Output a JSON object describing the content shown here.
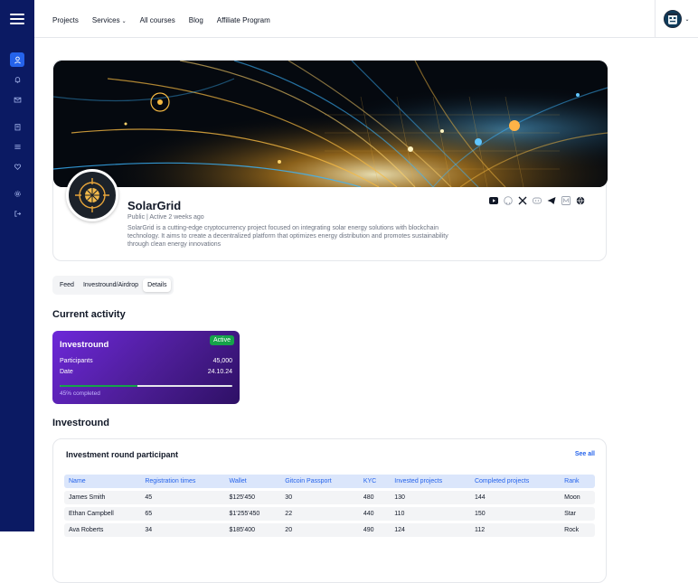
{
  "nav": {
    "items": [
      {
        "label": "Projects",
        "has_dropdown": false
      },
      {
        "label": "Services",
        "has_dropdown": true
      },
      {
        "label": "All courses",
        "has_dropdown": false
      },
      {
        "label": "Blog",
        "has_dropdown": false
      },
      {
        "label": "Affiliate Program",
        "has_dropdown": false
      }
    ],
    "chevron": "⌄"
  },
  "sidebar": {
    "icons": [
      "user-icon",
      "bell-icon",
      "mail-icon",
      "clipboard-icon",
      "list-icon",
      "heart-icon",
      "settings-icon",
      "logout-icon"
    ],
    "active": "user-icon"
  },
  "profile": {
    "name": "SolarGrid",
    "meta": "Public | Active 2 weeks ago",
    "description": "SolarGrid is a cutting-edge cryptocurrency project focused on integrating solar energy solutions with blockchain technology. It aims to create a decentralized platform that optimizes energy distribution and promotes sustainability through clean energy innovations",
    "socials": [
      "youtube-icon",
      "github-icon",
      "x-icon",
      "discord-icon",
      "telegram-icon",
      "medium-icon",
      "globe-icon"
    ]
  },
  "tabs": {
    "feed": "Feed",
    "investround": "Investround/Airdrop",
    "details": "Details",
    "active": "details"
  },
  "current_activity": {
    "heading": "Current activity",
    "card": {
      "title": "Investround",
      "badge": "Active",
      "participants_label": "Participants",
      "participants_value": "45,000",
      "date_label": "Date",
      "date_value": "24.10.24",
      "progress": 0.45,
      "completed_text": "45% completed"
    }
  },
  "investround": {
    "heading": "Investround",
    "table_title": "Investment round participant",
    "see_all": "See all",
    "columns": [
      "Name",
      "Registration times",
      "Wallet",
      "Gitcoin Passport",
      "KYC",
      "Invested projects",
      "Completed projects",
      "Rank"
    ],
    "rows": [
      [
        "James Smith",
        "45",
        "$125'450",
        "30",
        "480",
        "130",
        "144",
        "Moon"
      ],
      [
        "Ethan Campbell",
        "65",
        "$1'255'450",
        "22",
        "440",
        "110",
        "150",
        "Star"
      ],
      [
        "Ava Roberts",
        "34",
        "$185'400",
        "20",
        "490",
        "124",
        "112",
        "Rock"
      ]
    ]
  },
  "colors": {
    "sidebar": "#0b1a63",
    "accent": "#2563eb",
    "card_gradient_start": "#6d28d9",
    "card_gradient_end": "#2e1065",
    "active_badge": "#16a34a"
  }
}
